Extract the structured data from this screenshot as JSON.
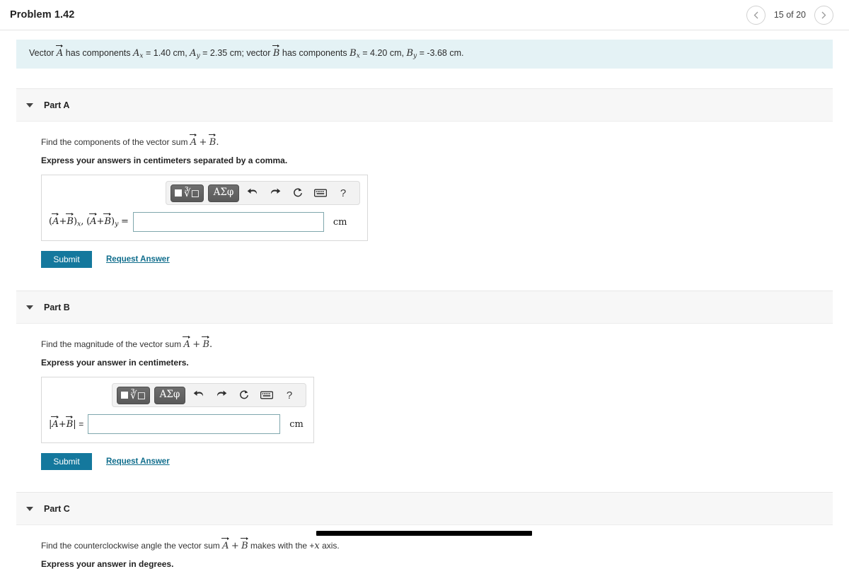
{
  "header": {
    "problem_title": "Problem 1.42",
    "pager": {
      "prev_icon": "chevron-left-icon",
      "next_icon": "chevron-right-icon",
      "count_label": "15 of 20",
      "current": 15,
      "total": 20
    }
  },
  "statement": {
    "text_parts": {
      "lead": "Vector",
      "vec_a": "A",
      "mid1": "has components",
      "ax_sym": "A",
      "ax_sub": "x",
      "ax_eq": "= 1.40 cm,",
      "ay_sym": "A",
      "ay_sub": "y",
      "ay_eq": "= 2.35 cm; vector",
      "vec_b": "B",
      "mid2": "has components",
      "bx_sym": "B",
      "bx_sub": "x",
      "bx_eq": "= 4.20 cm,",
      "by_sym": "B",
      "by_sub": "y",
      "by_eq": "= -3.68 cm."
    },
    "values": {
      "Ax": "1.40 cm",
      "Ay": "2.35 cm",
      "Bx": "4.20 cm",
      "By": "-3.68 cm"
    },
    "background_color": "#e4f2f5"
  },
  "toolbar": {
    "math_template_key": "math-template-key",
    "greek_key_label": "ΑΣφ",
    "undo_icon": "undo-arrow-icon",
    "redo_icon": "redo-arrow-icon",
    "reset_icon": "reset-circle-icon",
    "keyboard_icon": "keyboard-icon",
    "help_label": "?"
  },
  "parts": {
    "a": {
      "label": "Part A",
      "prompt_lead": "Find the components of the vector sum",
      "prompt_vec_a": "A",
      "prompt_plus": "+",
      "prompt_vec_b": "B",
      "prompt_end": ".",
      "instruction": "Express your answers in centimeters separated by a comma.",
      "formula": {
        "open1": "(",
        "vec_a": "A",
        "plus": "+",
        "vec_b": "B",
        "close1": ")",
        "sub1": "x",
        "comma": ",",
        "open2": "(",
        "close2": ")",
        "sub2": "y",
        "equals": "="
      },
      "input_value": "",
      "input_placeholder": "",
      "unit": "cm",
      "submit_label": "Submit",
      "request_label": "Request Answer"
    },
    "b": {
      "label": "Part B",
      "prompt_lead": "Find the magnitude of the vector sum",
      "prompt_vec_a": "A",
      "prompt_plus": "+",
      "prompt_vec_b": "B",
      "prompt_end": ".",
      "instruction": "Express your answer in centimeters.",
      "formula": {
        "bar_open": "|",
        "vec_a": "A",
        "plus": "+",
        "vec_b": "B",
        "bar_close": "|",
        "equals": "="
      },
      "input_value": "",
      "input_placeholder": "",
      "unit": "cm",
      "submit_label": "Submit",
      "request_label": "Request Answer"
    },
    "c": {
      "label": "Part C",
      "prompt_lead": "Find the counterclockwise angle the vector sum",
      "prompt_vec_a": "A",
      "prompt_plus": "+",
      "prompt_vec_b": "B",
      "prompt_tail": "makes with the +",
      "prompt_axis": "x",
      "prompt_end": "axis.",
      "instruction": "Express your answer in degrees."
    }
  },
  "colors": {
    "submit_button": "#14789d",
    "link": "#0f6d8c",
    "statement_bg": "#e4f2f5",
    "part_header_bg": "#f7f7f7",
    "input_border": "#7fa7ad"
  },
  "scrollbar": {
    "name": "horizontal-scrollbar-thumb"
  }
}
